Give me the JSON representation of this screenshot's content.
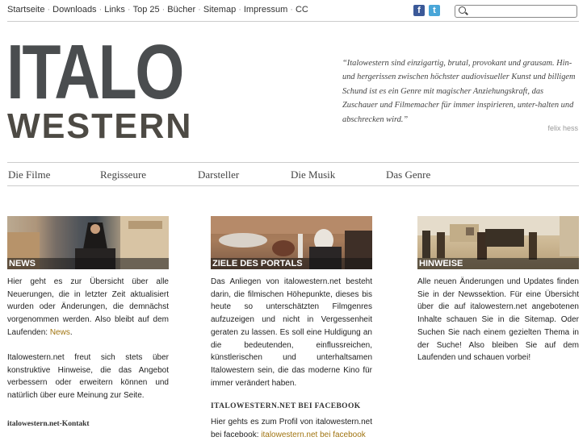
{
  "topnav": {
    "items": [
      "Startseite",
      "Downloads",
      "Links",
      "Top 25",
      "Bücher",
      "Sitemap",
      "Impressum",
      "CC"
    ]
  },
  "social": {
    "facebook_glyph": "f",
    "twitter_glyph": "t"
  },
  "search": {
    "value": "",
    "placeholder": ""
  },
  "logo": {
    "line1": "ITALO",
    "line2": "WESTERN"
  },
  "quote": {
    "text": "“Italowestern sind einzigartig, brutal, provokant und grausam. Hin- und hergerissen zwischen höchster audiovisueller Kunst und billigem Schund ist es ein Genre mit magischer Anziehungskraft, das Zuschauer und Filmemacher für immer inspirieren, unter-halten und abschrecken wird.”",
    "author": "felix hess"
  },
  "mainnav": {
    "items": [
      "Die Filme",
      "Regisseure",
      "Darsteller",
      "Die Musik",
      "Das Genre"
    ]
  },
  "columns": {
    "news": {
      "caption": "NEWS",
      "p1_before": "Hier geht es zur Übersicht über alle Neuerungen, die in letzter Zeit aktualisiert wurden oder Änderungen, die demnächst vorgenommen werden. Also bleibt auf dem Laufenden: ",
      "p1_link": "News",
      "p1_after": ".",
      "p2": "Italowestern.net freut sich stets über konstruktive Hinweise, die das Angebot verbessern oder erweitern können und natürlich über eure Meinung zur Seite.",
      "contact": "italowestern.net-Kontakt"
    },
    "ziele": {
      "caption": "ZIELE DES PORTALS",
      "p1": "Das Anliegen von italowestern.net besteht darin, die filmischen Höhepunkte, dieses bis heute so unterschätzten Filmgenres aufzuzeigen und nicht in Vergessenheit geraten zu lassen. Es soll eine Huldigung an die bedeutenden, einflussreichen, künstlerischen und unterhaltsamen Italowestern sein, die das moderne Kino für immer verändert haben.",
      "fb_heading": "ITALOWESTERN.NET BEI FACEBOOK",
      "fb_text": "Hier gehts es zum Profil von italowestern.net bei facebook: ",
      "fb_link": "italowestern.net bei facebook"
    },
    "hinweise": {
      "caption": "HINWEISE",
      "p1": "Alle neuen Änderungen und Updates finden Sie in der Newssektion. Für eine Übersicht über die auf italowestern.net angebotenen Inhalte schauen Sie in die Sitemap. Oder Suchen Sie nach einem gezielten Thema in der Suche! Also bleiben Sie auf dem Laufenden und schauen vorbei!"
    }
  },
  "colors": {
    "link": "#a07410",
    "facebook": "#3b5998",
    "twitter": "#49a6d8"
  }
}
